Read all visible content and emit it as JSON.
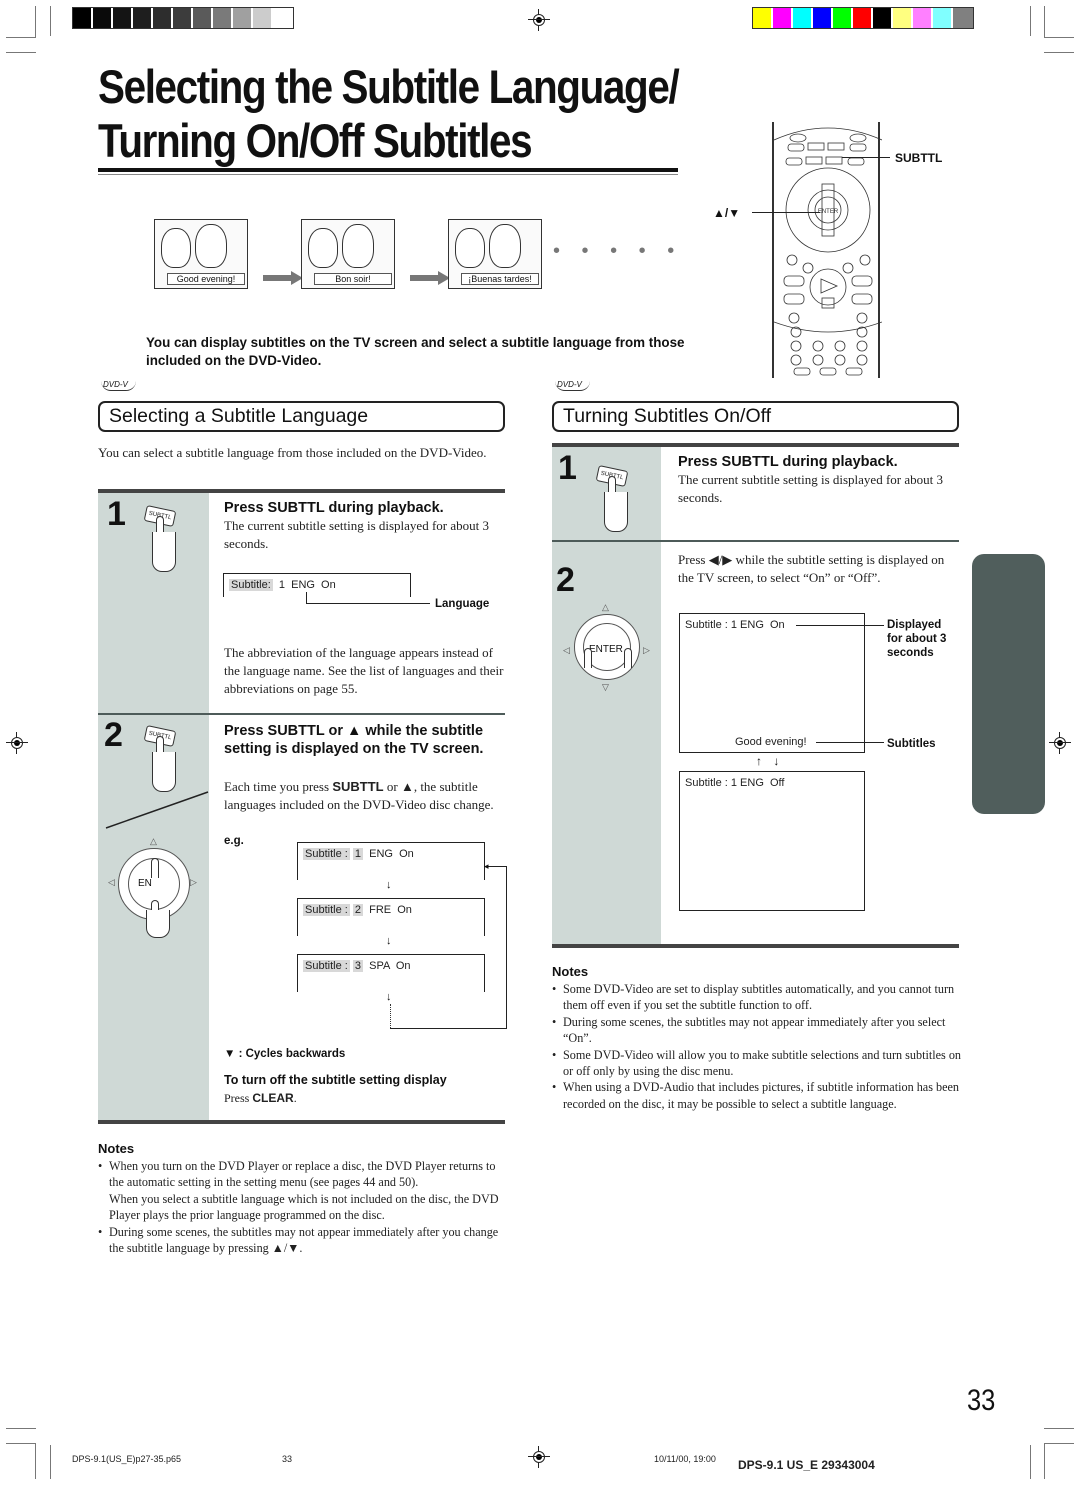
{
  "page": {
    "title_line1": "Selecting the Subtitle Language/",
    "title_line2": "Turning On/Off Subtitles",
    "page_number": "33",
    "gray_swatches": [
      "#000000",
      "#0a0a0a",
      "#141414",
      "#1e1e1e",
      "#2d2d2d",
      "#3c3c3c",
      "#5a5a5a",
      "#7a7a7a",
      "#a0a0a0",
      "#cccccc",
      "#ffffff"
    ],
    "color_swatches": [
      "#ffff00",
      "#ff00ff",
      "#00ffff",
      "#0000ff",
      "#00ff00",
      "#ff0000",
      "#000000",
      "#ffff80",
      "#ff80ff",
      "#80ffff",
      "#808080"
    ]
  },
  "remote": {
    "subttl_label": "SUBTTL",
    "updown_label": "▲/▼",
    "enter_label": "ENTER"
  },
  "illustration": {
    "captions": [
      "Good evening!",
      "Bon soir!",
      "¡Buenas tardes!"
    ],
    "continuation": "• • • • •"
  },
  "intro": "You can display subtitles on the TV screen and select a subtitle language from those included on the DVD-Video.",
  "left_section": {
    "disc_badge": "DVD-V",
    "heading": "Selecting a Subtitle Language",
    "description": "You can select a subtitle language from those included on the DVD-Video.",
    "steps": [
      {
        "number": "1",
        "button_icon": "SUBTTL",
        "heading": "Press SUBTTL during playback.",
        "text": "The current subtitle setting is displayed for about 3 seconds.",
        "osd": "Subtitle:  1  ENG  On",
        "osd_label": "Subtitle:",
        "osd_value": "1  ENG  On",
        "callout": "Language",
        "after_text": "The abbreviation of the language appears instead of the language name. See the list of languages and their abbreviations on page 55."
      },
      {
        "number": "2",
        "button_icon": "SUBTTL",
        "heading": "Press SUBTTL or ▲ while the subtitle setting is displayed on the TV screen.",
        "text_pre": "Each time you press ",
        "text_bold1": "SUBTTL",
        "text_mid": " or ",
        "text_bold2": "▲",
        "text_post": ", the subtitle languages included on the DVD-Video disc change.",
        "eg_label": "e.g.",
        "dial_label": "EN",
        "cycle": [
          {
            "label": "Subtitle :",
            "num": "1",
            "lang": "ENG",
            "state": "On"
          },
          {
            "label": "Subtitle :",
            "num": "2",
            "lang": "FRE",
            "state": "On"
          },
          {
            "label": "Subtitle :",
            "num": "3",
            "lang": "SPA",
            "state": "On"
          }
        ],
        "cycles_backwards": "▼ : Cycles backwards",
        "turn_off_heading": "To turn off the subtitle setting display",
        "turn_off_pre": "Press ",
        "turn_off_bold": "CLEAR",
        "turn_off_post": "."
      }
    ],
    "notes_title": "Notes",
    "notes": [
      {
        "bullet": true,
        "text": "When you turn on the DVD Player or replace a disc, the DVD Player returns to the automatic setting in the setting menu (see pages 44 and 50)."
      },
      {
        "bullet": false,
        "text": "When you select a subtitle language which is not included on the disc, the DVD Player plays the prior language programmed on the disc."
      },
      {
        "bullet": true,
        "text": "During some scenes, the subtitles may not appear immediately after you change the subtitle language by pressing ▲/▼."
      }
    ]
  },
  "right_section": {
    "disc_badge": "DVD-V",
    "heading": "Turning Subtitles On/Off",
    "steps": [
      {
        "number": "1",
        "button_icon": "SUBTTL",
        "heading": "Press SUBTTL during playback.",
        "text": "The current subtitle setting is displayed for about 3 seconds."
      },
      {
        "number": "2",
        "text": "Press ◀/▶ while the subtitle setting is displayed on the TV screen, to select “On” or “Off”.",
        "dial_label": "ENTER",
        "screen_on": "Subtitle : 1 ENG  On",
        "screen_subtitle": "Good evening!",
        "screen_off": "Subtitle : 1 ENG  Off",
        "callout_displayed": "Displayed for about 3 seconds",
        "callout_subtitles": "Subtitles",
        "toggle_arrows": "↑ ↓"
      }
    ],
    "notes_title": "Notes",
    "notes": [
      "Some DVD-Video are set to display subtitles automatically, and you cannot turn them off even if you set the subtitle function to off.",
      "During some scenes, the subtitles may not appear immediately after you select “On”.",
      "Some DVD-Video will allow you to make subtitle selections and turn subtitles on or off only by using the disc menu.",
      "When using a DVD-Audio that includes pictures, if subtitle information has been recorded on the disc, it may be possible to select a subtitle language."
    ]
  },
  "footer": {
    "file": "DPS-9.1(US_E)p27-35.p65",
    "page": "33",
    "date": "10/11/00, 19:00",
    "model": "DPS-9.1 US_E  29343004"
  }
}
